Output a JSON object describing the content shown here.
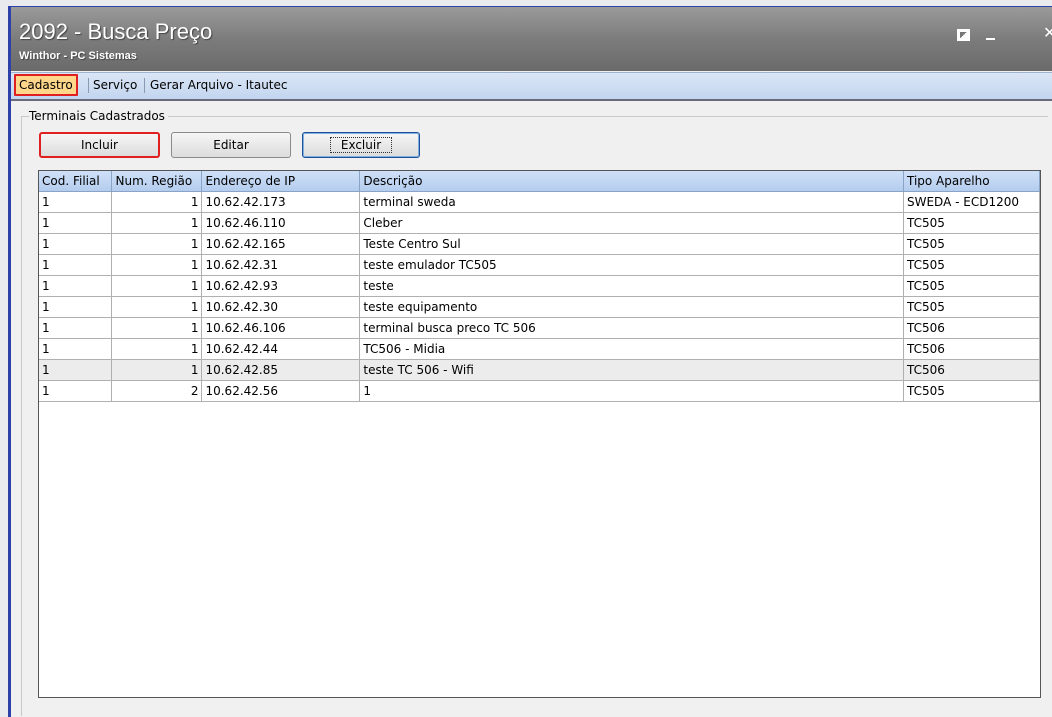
{
  "window": {
    "title": "2092 - Busca Preço",
    "subtitle": "Winthor - PC Sistemas"
  },
  "menu": {
    "tabs": [
      {
        "label": "Cadastro",
        "active": true
      },
      {
        "label": "Serviço",
        "active": false
      },
      {
        "label": "Gerar Arquivo - Itautec",
        "active": false
      }
    ]
  },
  "group": {
    "label": "Terminais Cadastrados"
  },
  "toolbar": {
    "incluir_label": "Incluir",
    "editar_label": "Editar",
    "excluir_label": "Excluir"
  },
  "grid": {
    "columns": [
      "Cod. Filial",
      "Num. Região",
      "Endereço de IP",
      "Descrição",
      "Tipo Aparelho"
    ],
    "rows": [
      [
        "1",
        "1",
        "10.62.42.173",
        "terminal sweda",
        "SWEDA - ECD1200"
      ],
      [
        "1",
        "1",
        "10.62.46.110",
        "Cleber",
        "TC505"
      ],
      [
        "1",
        "1",
        "10.62.42.165",
        "Teste Centro Sul",
        "TC505"
      ],
      [
        "1",
        "1",
        "10.62.42.31",
        "teste emulador TC505",
        "TC505"
      ],
      [
        "1",
        "1",
        "10.62.42.93",
        "teste",
        "TC505"
      ],
      [
        "1",
        "1",
        "10.62.42.30",
        "teste equipamento",
        "TC505"
      ],
      [
        "1",
        "1",
        "10.62.46.106",
        "terminal busca preco TC 506",
        "TC506"
      ],
      [
        "1",
        "1",
        "10.62.42.44",
        "TC506 - Midia",
        "TC506"
      ],
      [
        "1",
        "1",
        "10.62.42.85",
        "teste TC 506 - Wifi",
        "TC506"
      ],
      [
        "1",
        "2",
        "10.62.42.56",
        "1",
        "TC505"
      ]
    ]
  }
}
